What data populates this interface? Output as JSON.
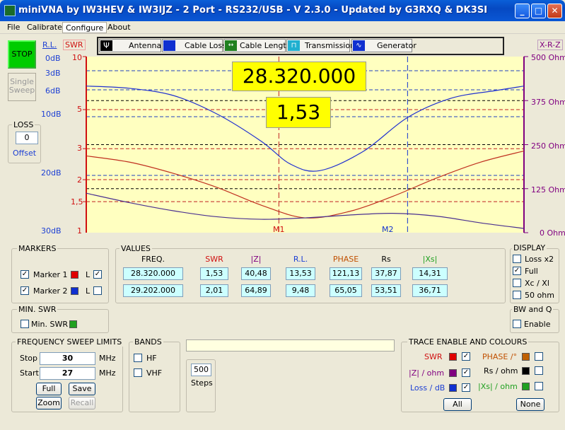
{
  "window": {
    "title": "miniVNA by IW3HEV & IW3IJZ - 2 Port - RS232/USB - V 2.3.0 - Updated by G3RXQ & DK3SI",
    "minimize": "_",
    "maximize": "□",
    "close": "✕"
  },
  "menu": [
    "File",
    "Calibrate",
    "Configure",
    "About"
  ],
  "left": {
    "stop_label": "STOP",
    "single_sweep_label": "Single Sweep"
  },
  "axes": {
    "rl_header": "R.L.",
    "swr_header": "SWR",
    "xrz_header": "X-R-Z",
    "rl_ticks": [
      "0dB",
      "3dB",
      "6dB",
      "10dB",
      "20dB",
      "30dB"
    ],
    "swr_ticks": [
      "10",
      "5",
      "3",
      "2",
      "1,5",
      "1"
    ],
    "ohm_ticks": [
      "500 Ohm",
      "375 Ohm",
      "250 Ohm",
      "125 Ohm",
      "0 Ohm"
    ]
  },
  "loss": {
    "title": "LOSS",
    "value": "0",
    "offset_label": "Offset"
  },
  "modes": [
    "Antenna",
    "Cable Loss",
    "Cable Length",
    "Transmission",
    "Generator"
  ],
  "chart_display": {
    "frequency": "28.320.000",
    "swr": "1,53",
    "marker1": "M1",
    "marker2": "M2"
  },
  "chart_data": {
    "type": "line",
    "title": "",
    "x_range_mhz": [
      27,
      30
    ],
    "markers": [
      {
        "name": "M1",
        "x": 28.32
      },
      {
        "name": "M2",
        "x": 29.202
      }
    ],
    "series": [
      {
        "name": "SWR",
        "color": "#2030d0",
        "x": [
          27.0,
          27.3,
          27.6,
          27.9,
          28.2,
          28.4,
          28.6,
          28.9,
          29.2,
          29.5,
          29.8,
          30.0
        ],
        "values": [
          6.8,
          6.6,
          6.0,
          4.7,
          3.3,
          2.45,
          2.25,
          2.9,
          4.5,
          5.8,
          6.4,
          6.8
        ]
      },
      {
        "name": "|Z|",
        "color": "#c03020",
        "x": [
          27.0,
          27.3,
          27.6,
          27.9,
          28.2,
          28.5,
          28.8,
          29.1,
          29.4,
          29.7,
          30.0
        ],
        "values": [
          218,
          200,
          168,
          128,
          78,
          42,
          60,
          103,
          155,
          200,
          232
        ]
      },
      {
        "name": "Rs",
        "color": "#4a3090",
        "x": [
          27.0,
          27.3,
          27.6,
          27.9,
          28.2,
          28.5,
          28.8,
          29.1,
          29.4,
          29.7,
          30.0
        ],
        "values": [
          112,
          85,
          62,
          45,
          38,
          42,
          50,
          55,
          47,
          28,
          12
        ]
      }
    ]
  },
  "markers": {
    "title": "MARKERS",
    "m1": "Marker 1",
    "m2": "Marker 2",
    "l": "L",
    "m1_color": "#e00000",
    "m2_color": "#1030d0"
  },
  "values": {
    "title": "VALUES",
    "headers": [
      "FREQ.",
      "SWR",
      "|Z|",
      "R.L.",
      "PHASE",
      "Rs",
      "|Xs|"
    ],
    "header_colors": [
      "#000000",
      "#d01010",
      "#800080",
      "#1c3fd4",
      "#c05000",
      "#000000",
      "#20a020"
    ],
    "rows": [
      [
        "28.320.000",
        "1,53",
        "40,48",
        "13,53",
        "121,13",
        "37,87",
        "14,31"
      ],
      [
        "29.202.000",
        "2,01",
        "64,89",
        "9,48",
        "65,05",
        "53,51",
        "36,71"
      ]
    ]
  },
  "display": {
    "title": "DISPLAY",
    "items": [
      "Loss x2",
      "Full",
      "Xc / Xl",
      "50 ohm"
    ],
    "checked": [
      false,
      true,
      false,
      false
    ]
  },
  "minswr": {
    "title": "MIN. SWR",
    "label": "Min. SWR"
  },
  "bwq": {
    "title": "BW and Q",
    "label": "Enable"
  },
  "sweep": {
    "title": "FREQUENCY SWEEP LIMITS",
    "stop_label": "Stop",
    "stop_value": "30",
    "start_label": "Start",
    "start_value": "27",
    "unit": "MHz",
    "full": "Full",
    "save": "Save",
    "zoom": "Zoom",
    "recall": "Recall"
  },
  "bands": {
    "title": "BANDS",
    "hf": "HF",
    "vhf": "VHF"
  },
  "steps": {
    "value": "500",
    "label": "Steps"
  },
  "trace": {
    "title": "TRACE ENABLE AND COLOURS",
    "swr": "SWR",
    "z": "|Z| / ohm",
    "loss": "Loss / dB",
    "phase": "PHASE /°",
    "rs": "Rs / ohm",
    "xs": "|Xs| / ohm",
    "all": "All",
    "none": "None",
    "colors": {
      "swr": "#e00000",
      "z": "#800080",
      "loss": "#1030d0",
      "phase": "#c06000",
      "rs": "#000000",
      "xs": "#20a020"
    }
  }
}
